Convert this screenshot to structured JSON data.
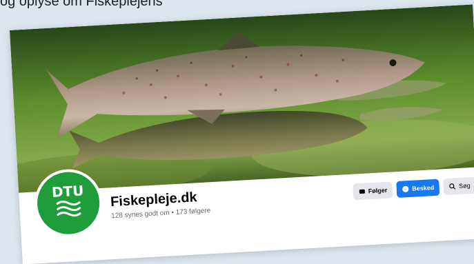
{
  "caption": {
    "text": "og oplyse om Fiskeplejens"
  },
  "page": {
    "name": "Fiskepleje.dk",
    "stats": "128 synes godt om • 173 følgere",
    "logo_text": "DTU"
  },
  "actions": {
    "follow_label": "Følger",
    "message_label": "Besked",
    "search_label": "Søg"
  },
  "colors": {
    "dtu_green": "#1f9d3b",
    "messenger_blue": "#1877f2",
    "button_grey": "#e4e6eb"
  },
  "icons": {
    "follow": "follow-icon",
    "message": "messenger-icon",
    "search": "search-icon"
  }
}
